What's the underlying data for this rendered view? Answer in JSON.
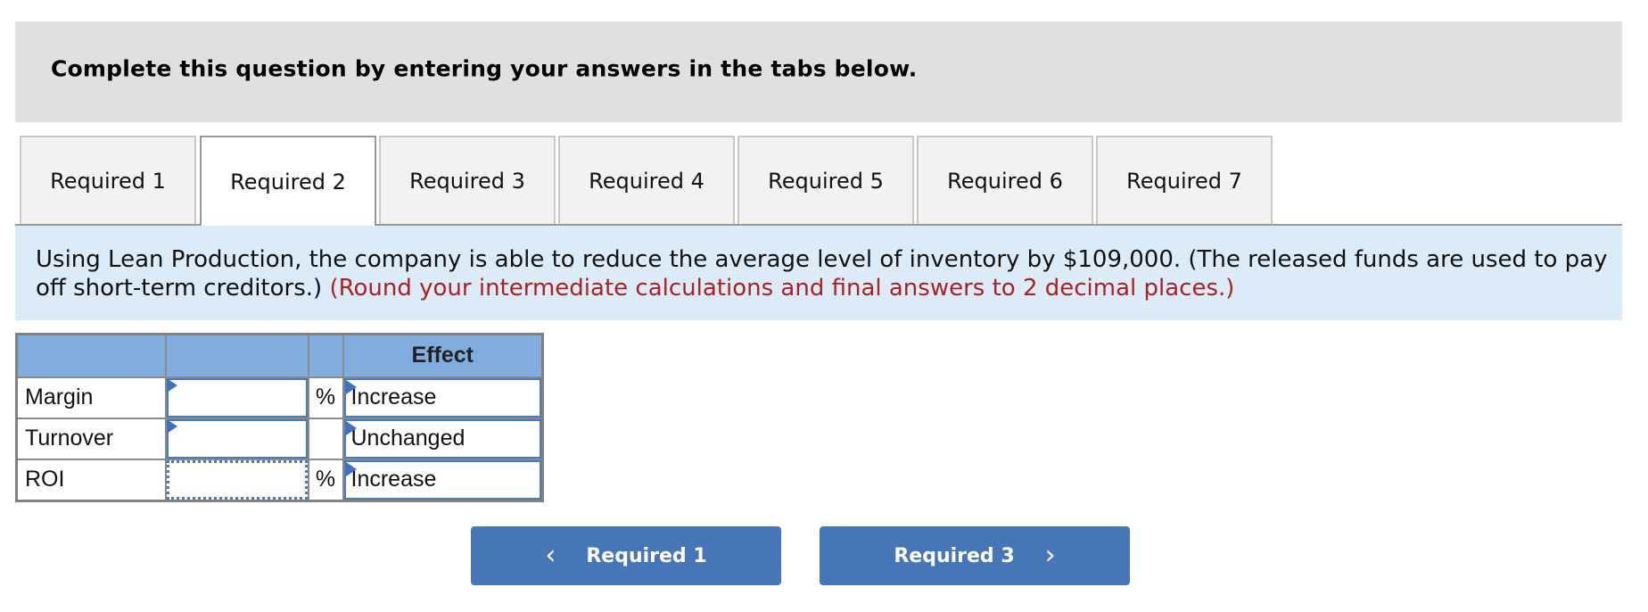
{
  "header": {
    "title": "Complete this question by entering your answers in the tabs below."
  },
  "tabs": [
    {
      "label": "Required 1",
      "active": false
    },
    {
      "label": "Required 2",
      "active": true
    },
    {
      "label": "Required 3",
      "active": false
    },
    {
      "label": "Required 4",
      "active": false
    },
    {
      "label": "Required 5",
      "active": false
    },
    {
      "label": "Required 6",
      "active": false
    },
    {
      "label": "Required 7",
      "active": false
    }
  ],
  "instructions": {
    "text": "Using Lean Production, the company is able to reduce the average level of inventory by $109,000. (The released funds are used to pay off short-term creditors.)",
    "note": "(Round your intermediate calculations and final answers to 2 decimal places.)"
  },
  "table": {
    "headers": [
      "",
      "",
      "",
      "Effect"
    ],
    "rows": [
      {
        "label": "Margin",
        "value": "",
        "unit": "%",
        "effect": "Increase"
      },
      {
        "label": "Turnover",
        "value": "",
        "unit": "",
        "effect": "Unchanged"
      },
      {
        "label": "ROI",
        "value": "",
        "unit": "%",
        "effect": "Increase"
      }
    ]
  },
  "navigation": {
    "prev_label": "Required 1",
    "prev_icon": "chevron-left-icon",
    "next_label": "Required 3",
    "next_icon": "chevron-right-icon"
  },
  "colors": {
    "header_bg": "#e0e0e0",
    "info_bg": "#dcebf8",
    "note_red": "#aa2222",
    "table_header_bg": "#80acde",
    "button_blue": "#4676b8",
    "input_border": "#4a7ac0"
  }
}
